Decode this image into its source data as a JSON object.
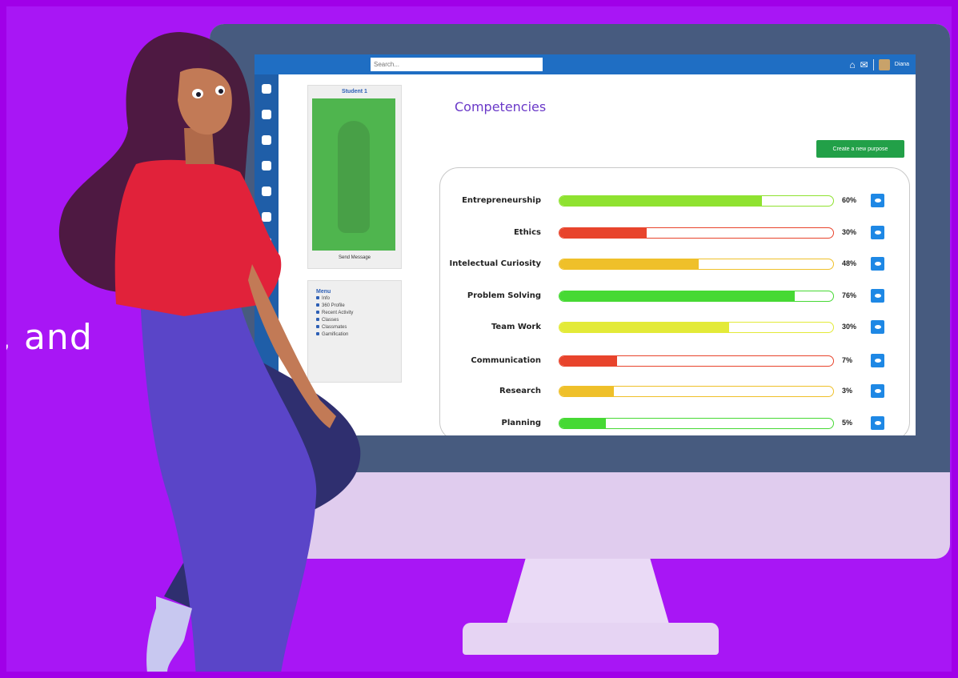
{
  "header": {
    "search_placeholder": "Search...",
    "user_name": "Diana"
  },
  "profile": {
    "title": "Student 1",
    "send_message": "Send Message"
  },
  "menu": {
    "title": "Menu",
    "items": [
      "Info",
      "360 Profile",
      "Recent Activity",
      "Classes",
      "Classmates",
      "Gamification"
    ]
  },
  "page": {
    "title": "Competencies",
    "create_button": "Create a new purpose"
  },
  "competencies": [
    {
      "label": "Entrepreneurship",
      "percent_text": "60%",
      "fill": 0.74,
      "color": "#8fe230"
    },
    {
      "label": "Ethics",
      "percent_text": "30%",
      "fill": 0.32,
      "color": "#e8442c"
    },
    {
      "label": "Intelectual Curiosity",
      "percent_text": "48%",
      "fill": 0.51,
      "color": "#efc02a"
    },
    {
      "label": "Problem Solving",
      "percent_text": "76%",
      "fill": 0.86,
      "color": "#46d934"
    },
    {
      "label": "Team Work",
      "percent_text": "30%",
      "fill": 0.62,
      "color": "#e3ea38"
    },
    {
      "label": "Communication",
      "percent_text": "7%",
      "fill": 0.21,
      "color": "#e8442c"
    },
    {
      "label": "Research",
      "percent_text": "3%",
      "fill": 0.2,
      "color": "#efc02a"
    },
    {
      "label": "Planning",
      "percent_text": "5%",
      "fill": 0.17,
      "color": "#46d934"
    }
  ],
  "overlay_text": ", and",
  "colors": {
    "background": "#a816f5",
    "topbar": "#1f6ec3",
    "title": "#6a39c8",
    "button": "#22a048",
    "view_button": "#1e88e5"
  }
}
